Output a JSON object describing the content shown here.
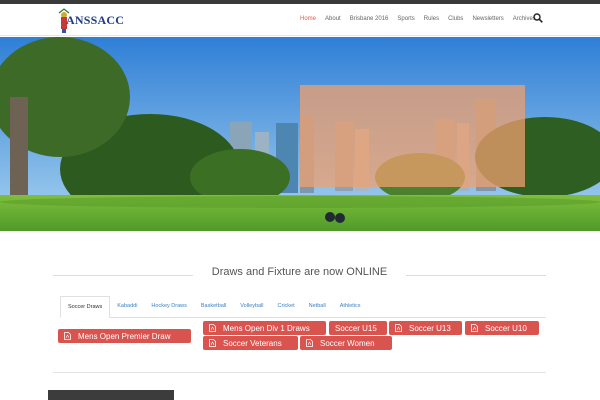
{
  "header": {
    "logo_text": "ANSSACC",
    "nav": [
      {
        "label": "Home",
        "active": true
      },
      {
        "label": "About",
        "active": false
      },
      {
        "label": "Brisbane 2016",
        "active": false
      },
      {
        "label": "Sports",
        "active": false
      },
      {
        "label": "Rules",
        "active": false
      },
      {
        "label": "Clubs",
        "active": false
      },
      {
        "label": "Newsletters",
        "active": false
      },
      {
        "label": "Archives",
        "active": false
      }
    ],
    "search_icon": "search-icon"
  },
  "section": {
    "title": "Draws and Fixture are now ONLINE"
  },
  "tabs": [
    {
      "label": "Soccer Draws",
      "active": true
    },
    {
      "label": "Kabaddi",
      "active": false
    },
    {
      "label": "Hockey Draws",
      "active": false
    },
    {
      "label": "Basketball",
      "active": false
    },
    {
      "label": "Volleyball",
      "active": false
    },
    {
      "label": "Cricket",
      "active": false
    },
    {
      "label": "Netball",
      "active": false
    },
    {
      "label": "Athletics",
      "active": false
    }
  ],
  "draw_buttons": [
    "Mens Open Premier Draw",
    "Mens Open Div 1 Draws",
    "Soccer U15",
    "Soccer U13",
    "Soccer U10",
    "Soccer Veterans",
    "Soccer Women"
  ],
  "colors": {
    "accent": "#d9534f",
    "nav_active": "#e55b4b",
    "tab_link": "#3b82c4"
  }
}
